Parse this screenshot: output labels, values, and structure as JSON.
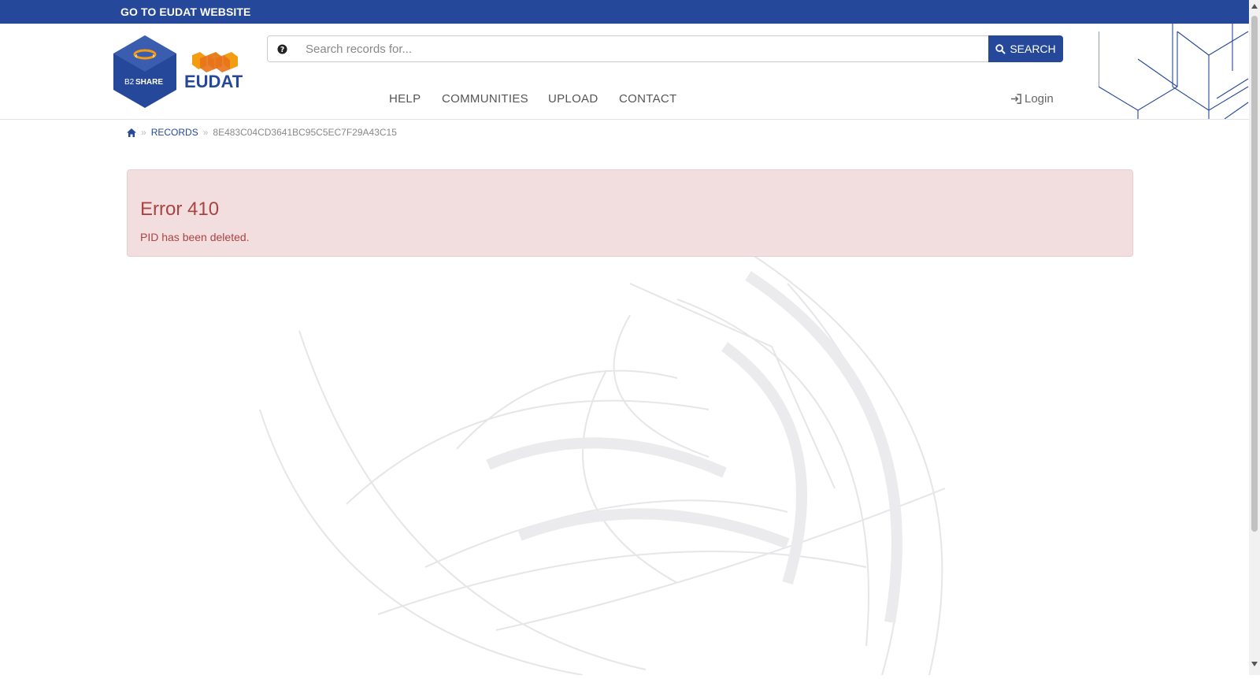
{
  "topbar": {
    "link_label": "GO TO EUDAT WEBSITE"
  },
  "logo": {
    "b2share_text_b2": "B2",
    "b2share_text_share": "SHARE",
    "eudat_text": "EUDAT"
  },
  "search": {
    "placeholder": "Search records for...",
    "button_label": "SEARCH",
    "help_icon": "question-circle-icon",
    "search_icon": "search-icon"
  },
  "nav": {
    "items": [
      {
        "label": "HELP"
      },
      {
        "label": "COMMUNITIES"
      },
      {
        "label": "UPLOAD"
      },
      {
        "label": "CONTACT"
      }
    ]
  },
  "login": {
    "label": "Login",
    "icon": "sign-in-icon"
  },
  "breadcrumb": {
    "home_icon": "home-icon",
    "records": "RECORDS",
    "current": "8E483C04CD3641BC95C5EC7F29A43C15",
    "separator": "»"
  },
  "error": {
    "title": "Error 410",
    "message": "PID has been deleted."
  },
  "colors": {
    "brand": "#26489a",
    "alert_bg": "#f2dede",
    "alert_text": "#a94442",
    "eudat_orange": "#f39c12"
  }
}
